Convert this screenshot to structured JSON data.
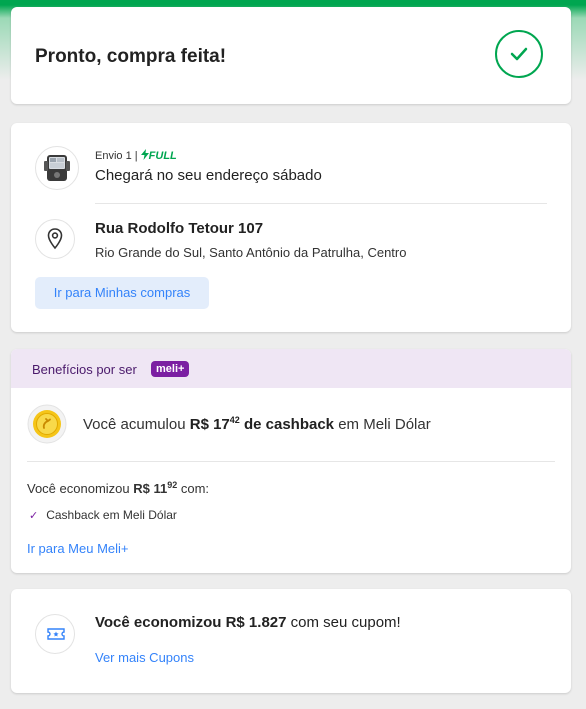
{
  "status": {
    "title": "Pronto, compra feita!"
  },
  "shipment": {
    "shipment_label": "Envio 1 |",
    "full_label": "FULL",
    "eta": "Chegará no seu endereço sábado",
    "address_street": "Rua Rodolfo Tetour 107",
    "address_detail": "Rio Grande do Sul, Santo Antônio da Patrulha, Centro",
    "purchases_button": "Ir para Minhas compras"
  },
  "benefits": {
    "header": "Benefícios por ser",
    "badge": "meli+",
    "cashback_prefix": "Você acumulou",
    "cashback_amount_int": "R$ 17",
    "cashback_amount_cents": "42",
    "cashback_bold_suffix": "de cashback",
    "cashback_suffix": "em Meli Dólar",
    "saved_prefix": "Você economizou",
    "saved_amount_int": "R$ 11",
    "saved_amount_cents": "92",
    "saved_suffix": "com:",
    "item_1": "Cashback em Meli Dólar",
    "link": "Ir para Meu Meli+"
  },
  "coupon": {
    "prefix": "Você economizou",
    "amount": "R$ 1.827",
    "suffix": "com seu cupom!",
    "link": "Ver mais Cupons"
  },
  "colors": {
    "success_green": "#00a650",
    "link_blue": "#3483fa",
    "meli_purple": "#7b1fa2"
  }
}
